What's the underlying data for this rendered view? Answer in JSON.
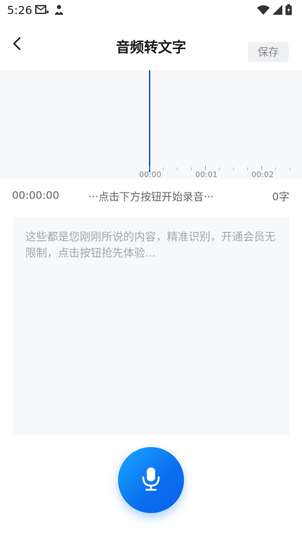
{
  "status_bar": {
    "time": "5:26"
  },
  "header": {
    "title": "音频转文字",
    "save_label": "保存"
  },
  "timeline": {
    "labels": [
      "00:00",
      "00:01",
      "00:02"
    ]
  },
  "info": {
    "elapsed": "00:00:00",
    "hint": "···点击下方按钮开始录音···",
    "char_count": "0字"
  },
  "transcript": {
    "placeholder": "这些都是您刚刚所说的内容，精准识别，开通会员无限制，点击按钮抢先体验..."
  },
  "colors": {
    "accent": "#0a6ef0",
    "playhead": "#1f5fa8"
  },
  "icons": {
    "back": "chevron-left-icon",
    "mic": "microphone-icon"
  }
}
